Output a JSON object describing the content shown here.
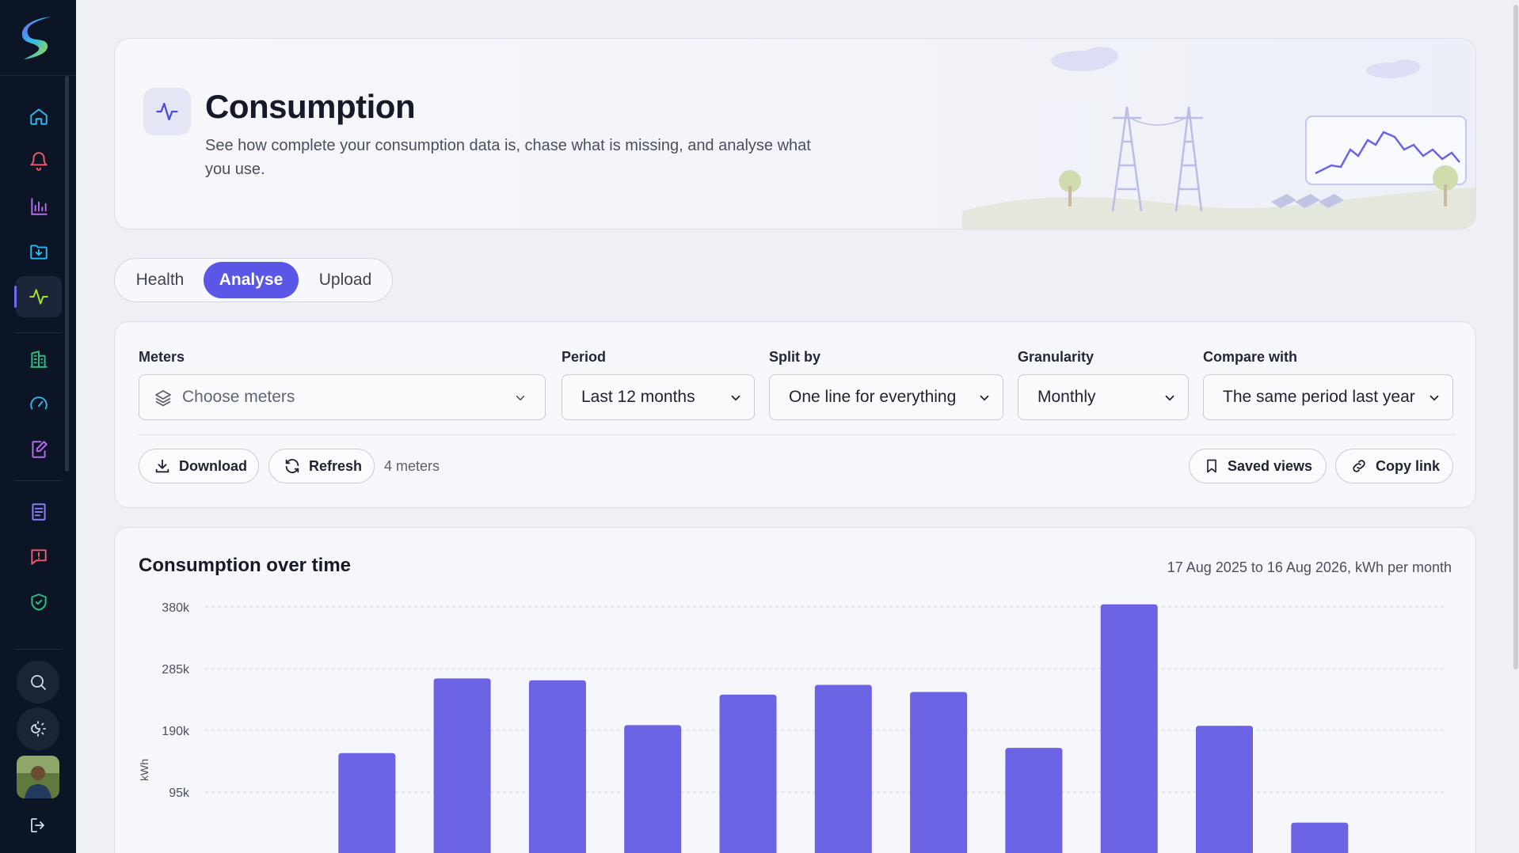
{
  "sidebar": {
    "items": [
      {
        "name": "home",
        "color": "#2fb8ee"
      },
      {
        "name": "alerts",
        "color": "#f05a6b"
      },
      {
        "name": "reports",
        "color": "#b46ee8"
      },
      {
        "name": "imports",
        "color": "#2fb8ee"
      },
      {
        "name": "consumption",
        "color": "#a6e22e",
        "active": true
      },
      {
        "name": "buildings",
        "color": "#27c07d"
      },
      {
        "name": "meters",
        "color": "#2fb8ee"
      },
      {
        "name": "edit",
        "color": "#b46ee8"
      },
      {
        "name": "documents",
        "color": "#8b7cf6"
      },
      {
        "name": "feedback",
        "color": "#f05a6b"
      },
      {
        "name": "compliance",
        "color": "#27c07d"
      }
    ]
  },
  "header": {
    "title": "Consumption",
    "subtitle": "See how complete your consumption data is, chase what is missing, and analyse what you use."
  },
  "tabs": [
    {
      "label": "Health",
      "active": false
    },
    {
      "label": "Analyse",
      "active": true
    },
    {
      "label": "Upload",
      "active": false
    }
  ],
  "filters": {
    "meters": {
      "label": "Meters",
      "placeholder": "Choose meters"
    },
    "period": {
      "label": "Period",
      "value": "Last 12 months"
    },
    "split": {
      "label": "Split by",
      "value": "One line for everything"
    },
    "granularity": {
      "label": "Granularity",
      "value": "Monthly"
    },
    "compare": {
      "label": "Compare with",
      "value": "The same period last year"
    }
  },
  "actions": {
    "download": "Download",
    "refresh": "Refresh",
    "meter_count": "4 meters",
    "saved_views": "Saved views",
    "copy_link": "Copy link"
  },
  "chart": {
    "title": "Consumption over time",
    "meta": "17 Aug 2025 to 16 Aug 2026, kWh per month"
  },
  "colors": {
    "accent": "#5a57e6",
    "bar": "#6b63e3",
    "sidebar_bg": "#0b1526"
  },
  "chart_data": {
    "type": "bar",
    "title": "Consumption over time",
    "subtitle": "17 Aug 2025 to 16 Aug 2026, kWh per month",
    "ylabel": "kWh",
    "yticks": [
      "380k",
      "285k",
      "190k",
      "95k"
    ],
    "ylim": [
      0,
      380000
    ],
    "grid": true,
    "series": [
      {
        "values": [
          0,
          155000,
          270000,
          267000,
          198000,
          245000,
          260000,
          249000,
          163000,
          384000,
          197000,
          48000
        ]
      }
    ]
  }
}
